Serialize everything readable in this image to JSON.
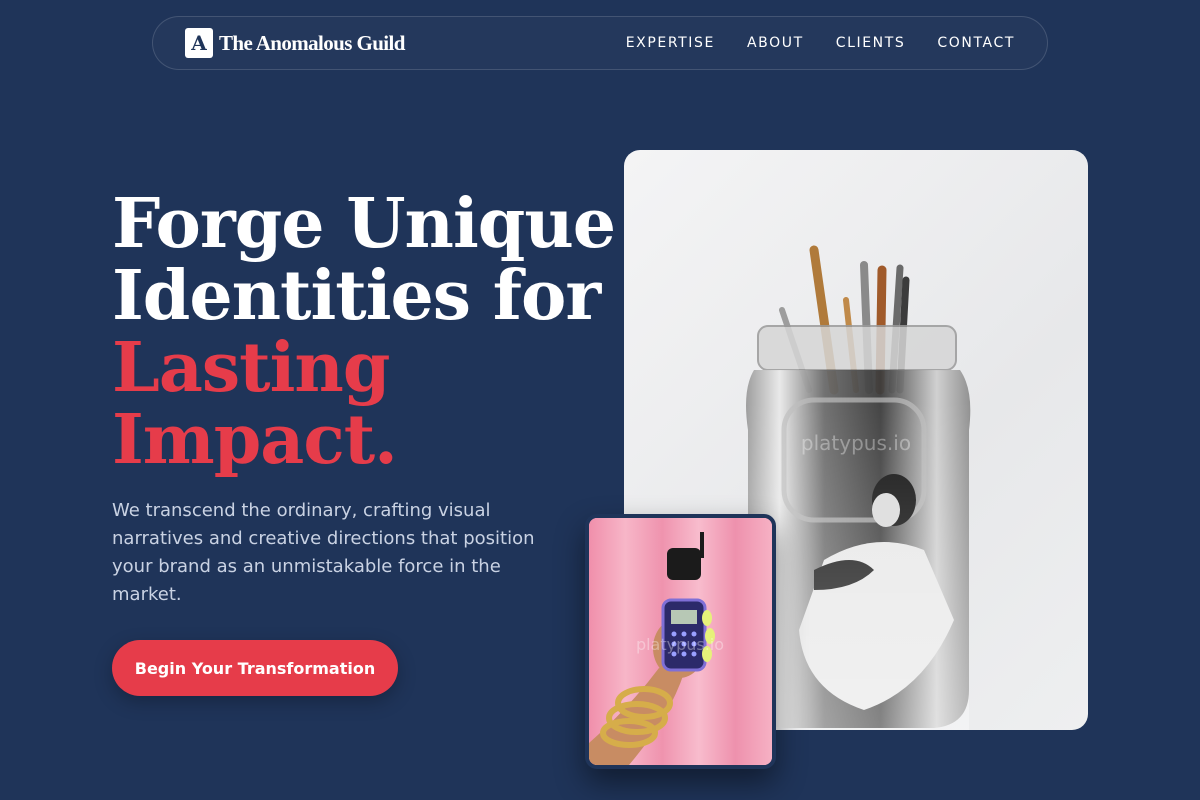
{
  "brand": {
    "mark": "A",
    "name": "The Anomalous Guild"
  },
  "nav": {
    "links": [
      {
        "label": "EXPERTISE"
      },
      {
        "label": "ABOUT"
      },
      {
        "label": "CLIENTS"
      },
      {
        "label": "CONTACT"
      }
    ]
  },
  "hero": {
    "headline_line1": "Forge Unique",
    "headline_line2": "Identities for",
    "headline_accent1": "Lasting",
    "headline_accent2": "Impact.",
    "subtext": "We transcend the ordinary, crafting visual narratives and creative directions that position your brand as an unmistakable force in the market.",
    "cta_label": "Begin Your Transformation"
  },
  "images": {
    "main": {
      "icon": "brush-jar-photo",
      "watermark": "platypus.io"
    },
    "secondary": {
      "icon": "flip-phone-photo",
      "watermark": "platypus.io"
    }
  },
  "colors": {
    "background": "#1f3459",
    "accent": "#e63c4a",
    "text": "#ffffff",
    "muted_text": "#c9d2e3"
  }
}
